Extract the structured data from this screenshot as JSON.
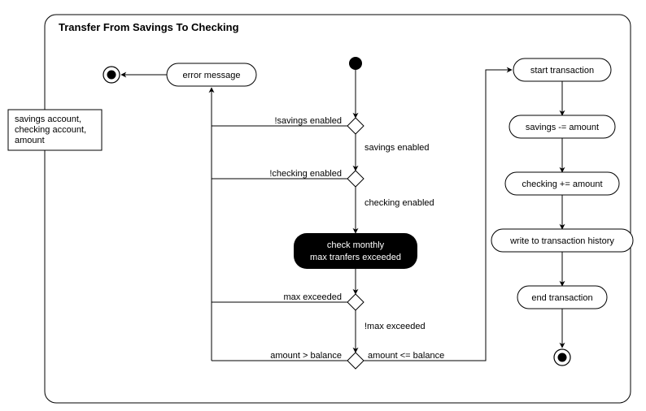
{
  "title": "Transfer From Savings To Checking",
  "input_note": {
    "line1": "savings account,",
    "line2": "checking account,",
    "line3": "amount"
  },
  "nodes": {
    "error_message": "error message",
    "check_action": {
      "line1": "check monthly",
      "line2": "max tranfers exceeded"
    },
    "start_transaction": "start transaction",
    "savings_minus": "savings -= amount",
    "checking_plus": "checking += amount",
    "write_history": "write to transaction history",
    "end_transaction": "end transaction"
  },
  "edges": {
    "not_savings_enabled": "!savings enabled",
    "savings_enabled": "savings enabled",
    "not_checking_enabled": "!checking enabled",
    "checking_enabled": "checking enabled",
    "max_exceeded": "max exceeded",
    "not_max_exceeded": "!max exceeded",
    "amount_gt_balance": "amount > balance",
    "amount_le_balance": "amount <= balance"
  },
  "chart_data": {
    "type": "uml-activity-diagram",
    "frame_title": "Transfer From Savings To Checking",
    "external_input": [
      "savings account",
      "checking account",
      "amount"
    ],
    "initial_node": "initial",
    "nodes": [
      {
        "id": "error_message",
        "kind": "action",
        "label": "error message"
      },
      {
        "id": "d1",
        "kind": "decision"
      },
      {
        "id": "d2",
        "kind": "decision"
      },
      {
        "id": "check_action",
        "kind": "action",
        "label": "check monthly max tranfers exceeded",
        "emphasis": true
      },
      {
        "id": "d3",
        "kind": "decision"
      },
      {
        "id": "d4",
        "kind": "decision"
      },
      {
        "id": "start_transaction",
        "kind": "action",
        "label": "start transaction"
      },
      {
        "id": "savings_minus",
        "kind": "action",
        "label": "savings -= amount"
      },
      {
        "id": "checking_plus",
        "kind": "action",
        "label": "checking += amount"
      },
      {
        "id": "write_history",
        "kind": "action",
        "label": "write to transaction history"
      },
      {
        "id": "end_transaction",
        "kind": "action",
        "label": "end transaction"
      },
      {
        "id": "final_left",
        "kind": "flow-final"
      },
      {
        "id": "final_right",
        "kind": "activity-final"
      }
    ],
    "edges": [
      {
        "from": "initial",
        "to": "d1"
      },
      {
        "from": "d1",
        "to": "error_message",
        "guard": "!savings enabled"
      },
      {
        "from": "d1",
        "to": "d2",
        "guard": "savings enabled"
      },
      {
        "from": "d2",
        "to": "error_message",
        "guard": "!checking enabled"
      },
      {
        "from": "d2",
        "to": "check_action",
        "guard": "checking enabled"
      },
      {
        "from": "check_action",
        "to": "d3"
      },
      {
        "from": "d3",
        "to": "error_message",
        "guard": "max exceeded"
      },
      {
        "from": "d3",
        "to": "d4",
        "guard": "!max exceeded"
      },
      {
        "from": "d4",
        "to": "error_message",
        "guard": "amount > balance"
      },
      {
        "from": "d4",
        "to": "start_transaction",
        "guard": "amount <= balance"
      },
      {
        "from": "start_transaction",
        "to": "savings_minus"
      },
      {
        "from": "savings_minus",
        "to": "checking_plus"
      },
      {
        "from": "checking_plus",
        "to": "write_history"
      },
      {
        "from": "write_history",
        "to": "end_transaction"
      },
      {
        "from": "end_transaction",
        "to": "final_right"
      },
      {
        "from": "error_message",
        "to": "final_left"
      }
    ]
  }
}
